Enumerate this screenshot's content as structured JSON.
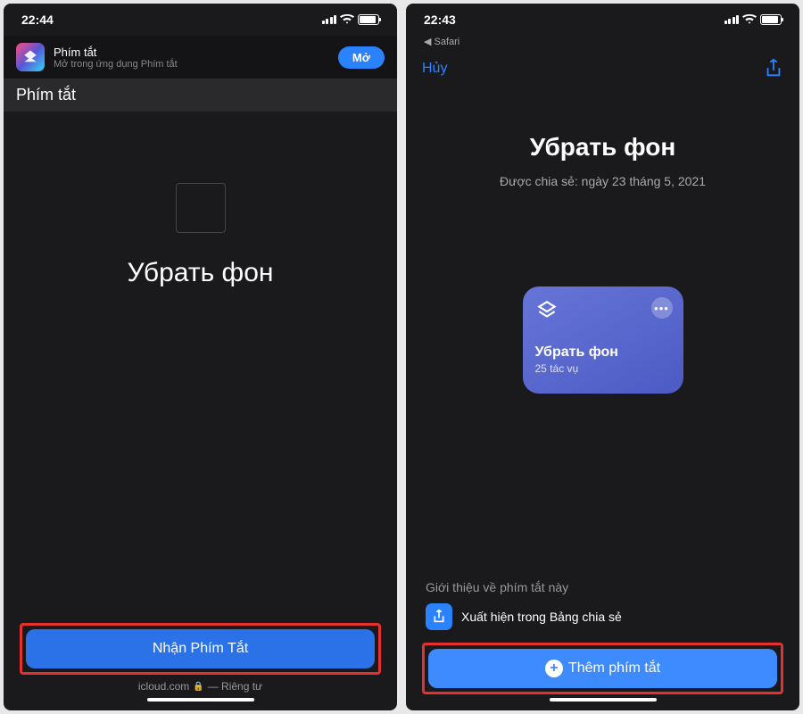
{
  "left": {
    "time": "22:44",
    "banner": {
      "name": "Phím tắt",
      "sub": "Mở trong ứng dụng Phím tắt",
      "open": "Mở"
    },
    "nav_title": "Phím tắt",
    "shortcut_title": "Убрать фон",
    "primary_btn": "Nhận Phím Tắt",
    "url_domain": "icloud.com",
    "url_private": "— Riêng tư"
  },
  "right": {
    "time": "22:43",
    "safari_back": "◀ Safari",
    "cancel": "Hủy",
    "title": "Убрать фон",
    "shared": "Được chia sẻ: ngày 23 tháng 5, 2021",
    "card": {
      "title": "Убрать фон",
      "count": "25 tác vụ"
    },
    "intro_label": "Giới thiệu về phím tắt này",
    "intro_item": "Xuất hiện trong Bảng chia sẻ",
    "primary_btn": "Thêm phím tắt"
  }
}
